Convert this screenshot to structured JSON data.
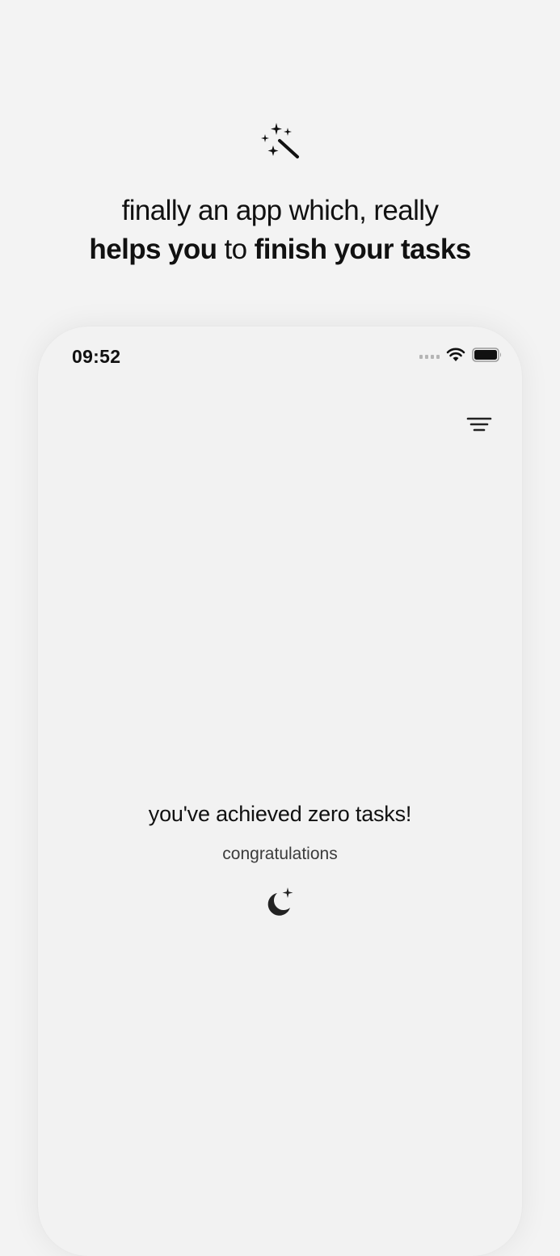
{
  "hero": {
    "icon": "magic-wand-sparkles-icon",
    "line1": "finally an app which, really",
    "line2_bold_1": "helps you",
    "line2_light": " to ",
    "line2_bold_2": "finish your tasks"
  },
  "status_bar": {
    "time": "09:52",
    "icons": [
      "cellular-signal-icon",
      "wifi-icon",
      "battery-icon"
    ]
  },
  "header": {
    "menu_icon": "filter-lines-icon"
  },
  "empty_state": {
    "title": "you've achieved zero tasks!",
    "subtitle": "congratulations",
    "icon": "moon-stars-icon"
  },
  "colors": {
    "background": "#f3f3f3",
    "phone_screen": "#f2f2f2",
    "text": "#111111",
    "muted_text": "#3c3c3c"
  }
}
